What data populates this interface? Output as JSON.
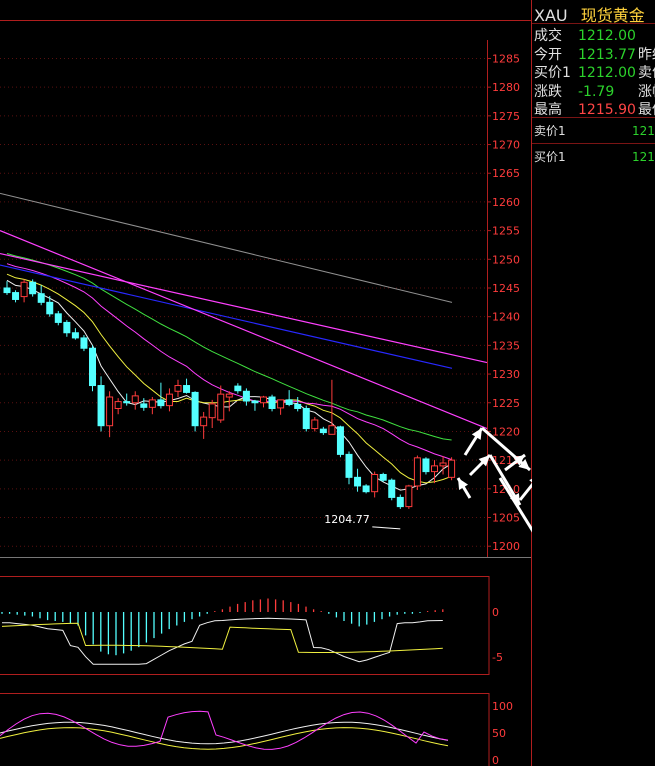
{
  "sidebar": {
    "symbol": "XAU",
    "name": "现货黄金",
    "quote_rows": [
      {
        "label": "成交",
        "value": "1212.00",
        "value_color": "green",
        "label2": ""
      },
      {
        "label": "今开",
        "value": "1213.77",
        "value_color": "green",
        "label2": "昨结"
      },
      {
        "label": "买价1",
        "value": "1212.00",
        "value_color": "green",
        "label2": "卖价"
      },
      {
        "label": "涨跌",
        "value": "-1.79",
        "value_color": "green",
        "label2": "涨幅"
      },
      {
        "label": "最高",
        "value": "1215.90",
        "value_color": "red",
        "label2": "最低"
      }
    ],
    "order_book": [
      {
        "label": "卖价1",
        "value": "121"
      },
      {
        "label": "买价1",
        "value": "121"
      }
    ]
  },
  "colors": {
    "up_candle": "#ff3c3c",
    "down_candle": "#54ffff",
    "frame": "#b01e1e",
    "ma_white": "#f0f0f0",
    "ma_yellow": "#f0f040",
    "ma_magenta": "#ff40ff",
    "ma_green": "#40e040",
    "ma_gray": "#909090",
    "trendline_pink": "#ff40ff",
    "trendline_blue": "#2828ff"
  },
  "chart_data": [
    {
      "type": "candlestick",
      "yaxis_ticks": [
        1200,
        1205,
        1210,
        1215,
        1220,
        1225,
        1230,
        1235,
        1240,
        1245,
        1250,
        1255,
        1260,
        1265,
        1270,
        1275,
        1280,
        1285
      ],
      "ylim": [
        1199,
        1286
      ],
      "annotation": "1204.77",
      "annotation_value": 1204.77,
      "grid": true,
      "candles": [
        [
          1245,
          1246.2,
          1243.8,
          1244.2
        ],
        [
          1244.2,
          1244.6,
          1242.5,
          1243
        ],
        [
          1243.5,
          1246.5,
          1242.5,
          1246
        ],
        [
          1246,
          1246.5,
          1243.5,
          1244
        ],
        [
          1244,
          1245.5,
          1242,
          1242.5
        ],
        [
          1242.5,
          1243.6,
          1240,
          1240.5
        ],
        [
          1240.5,
          1241,
          1238.5,
          1239
        ],
        [
          1239,
          1239.4,
          1236.5,
          1237.2
        ],
        [
          1237.2,
          1238,
          1236,
          1236.3
        ],
        [
          1236.3,
          1236.8,
          1234,
          1234.5
        ],
        [
          1234.5,
          1235,
          1227,
          1228
        ],
        [
          1228,
          1229.6,
          1220,
          1221
        ],
        [
          1221,
          1227,
          1219,
          1226
        ],
        [
          1224,
          1225.8,
          1223,
          1225.2
        ],
        [
          1225.2,
          1226.6,
          1224.5,
          1225
        ],
        [
          1225,
          1227,
          1223.8,
          1226.2
        ],
        [
          1224.8,
          1225.8,
          1223.6,
          1224.2
        ],
        [
          1224.2,
          1226,
          1223,
          1225.5
        ],
        [
          1225.5,
          1228.5,
          1224,
          1224.5
        ],
        [
          1224.5,
          1227.5,
          1223.5,
          1226.5
        ],
        [
          1227,
          1229,
          1226,
          1228
        ],
        [
          1228,
          1229.2,
          1226.6,
          1226.8
        ],
        [
          1226.8,
          1227,
          1220,
          1221
        ],
        [
          1221,
          1223.4,
          1218.7,
          1222.5
        ],
        [
          1222.4,
          1225.5,
          1220.6,
          1224.8
        ],
        [
          1222,
          1228,
          1221.5,
          1226.5
        ],
        [
          1226,
          1227,
          1223.5,
          1226.5
        ],
        [
          1227.9,
          1228.4,
          1226.6,
          1227.1
        ],
        [
          1227,
          1227.5,
          1224.5,
          1225.3
        ],
        [
          1225.3,
          1225.5,
          1223.6,
          1225
        ],
        [
          1225,
          1226.2,
          1224.2,
          1226
        ],
        [
          1226,
          1226.4,
          1223.5,
          1224
        ],
        [
          1224.1,
          1225.5,
          1222.9,
          1225.5
        ],
        [
          1225.5,
          1227.2,
          1224.4,
          1224.7
        ],
        [
          1224.7,
          1226,
          1223.5,
          1224
        ],
        [
          1224,
          1224.5,
          1220,
          1220.5
        ],
        [
          1220.5,
          1222.5,
          1220,
          1222
        ],
        [
          1220.4,
          1220.8,
          1219.4,
          1219.8
        ],
        [
          1219.5,
          1229,
          1220,
          1221
        ],
        [
          1220.8,
          1221,
          1215.5,
          1216
        ],
        [
          1216,
          1216.5,
          1210.8,
          1212
        ],
        [
          1212,
          1213.5,
          1209.5,
          1210.5
        ],
        [
          1210.5,
          1210.8,
          1209.2,
          1209.5
        ],
        [
          1209.5,
          1213,
          1208.5,
          1212.5
        ],
        [
          1212.5,
          1212.8,
          1211.2,
          1211.5
        ],
        [
          1211.5,
          1211.8,
          1208,
          1208.5
        ],
        [
          1208.5,
          1209,
          1206.5,
          1206.9
        ],
        [
          1206.9,
          1210.7,
          1206.5,
          1210.5
        ],
        [
          1210.5,
          1215.8,
          1209.8,
          1215.4
        ],
        [
          1215.2,
          1215.5,
          1212.5,
          1213
        ],
        [
          1213,
          1215,
          1211,
          1214
        ],
        [
          1214,
          1215.7,
          1212.5,
          1214.5
        ],
        [
          1212,
          1215.5,
          1211.5,
          1215
        ]
      ]
    },
    {
      "type": "bar",
      "yaxis_ticks": [
        0,
        -5
      ],
      "ylim": [
        -6,
        2
      ],
      "values": [
        -0.2,
        -0.2,
        -0.3,
        -0.4,
        -0.5,
        -0.7,
        -0.9,
        -1,
        -1.1,
        -1.3,
        -1.5,
        -2.6,
        -3.6,
        -4.4,
        -4.7,
        -4.8,
        -4.6,
        -4.3,
        -3.9,
        -3.4,
        -2.9,
        -2.4,
        -1.9,
        -1.5,
        -1.1,
        -0.8,
        -0.5,
        -0.2,
        0.1,
        0.3,
        0.6,
        0.9,
        1.1,
        1.3,
        1.4,
        1.5,
        1.4,
        1.3,
        1.1,
        0.9,
        0.6,
        0.3,
        0.1,
        -0.2,
        -0.6,
        -1,
        -1.3,
        -1.6,
        -1.4,
        -1.1,
        -0.8,
        -0.5,
        -0.3,
        -0.2,
        -0.2,
        -0.1,
        0.1,
        0.2,
        0.3
      ]
    },
    {
      "type": "line",
      "yaxis_ticks": [
        100,
        50,
        0
      ],
      "ylim": [
        0,
        110
      ]
    }
  ]
}
